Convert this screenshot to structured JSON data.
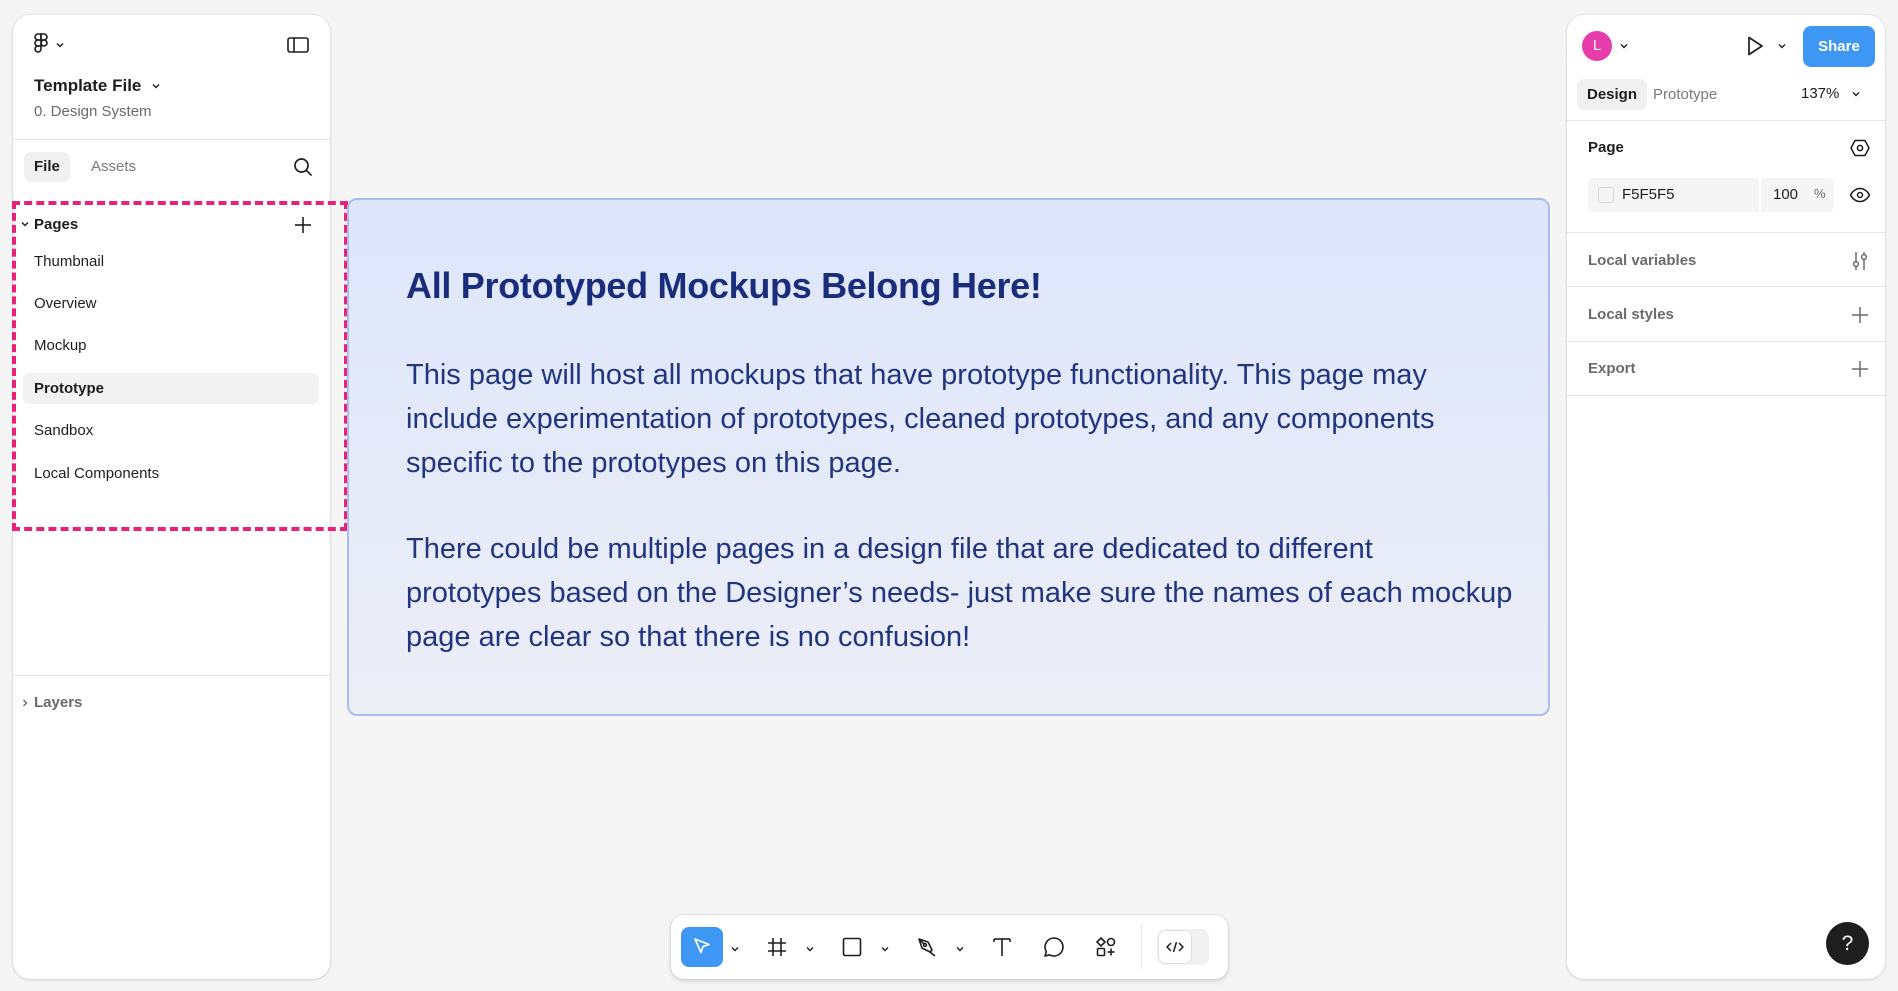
{
  "left_panel": {
    "file_title": "Template File",
    "file_subtitle": "0. Design System",
    "tabs": [
      {
        "label": "File",
        "active": true
      },
      {
        "label": "Assets",
        "active": false
      }
    ],
    "pages_label": "Pages",
    "pages": [
      {
        "label": "Thumbnail",
        "selected": false
      },
      {
        "label": "Overview",
        "selected": false
      },
      {
        "label": "Mockup",
        "selected": false
      },
      {
        "label": "Prototype",
        "selected": true
      },
      {
        "label": "Sandbox",
        "selected": false
      },
      {
        "label": "Local Components",
        "selected": false
      }
    ],
    "layers_label": "Layers",
    "highlight_color": "#E8217A"
  },
  "canvas": {
    "heading": "All Prototyped Mockups Belong Here!",
    "paragraphs": [
      "This page will host all mockups that have prototype functionality. This page may include experimentation of prototypes, cleaned prototypes, and any components specific to the prototypes on this page.",
      "There could be multiple pages in a design file that are dedicated to different prototypes based on the Designer’s needs- just make sure the names of each mockup page are clear so that there is no confusion!"
    ],
    "frame_border_color": "#A9BDF0",
    "text_color": "#1A2D7A"
  },
  "toolbar": {
    "tools": [
      {
        "name": "move-tool",
        "icon": "cursor-icon",
        "active": true
      },
      {
        "name": "frame-tool",
        "icon": "frame-icon",
        "active": false
      },
      {
        "name": "shape-tool",
        "icon": "rectangle-icon",
        "active": false
      },
      {
        "name": "pen-tool",
        "icon": "pen-icon",
        "active": false
      },
      {
        "name": "text-tool",
        "icon": "text-icon",
        "active": false
      },
      {
        "name": "comment-tool",
        "icon": "comment-icon",
        "active": false
      },
      {
        "name": "actions-tool",
        "icon": "components-icon",
        "active": false
      },
      {
        "name": "dev-mode-toggle",
        "icon": "code-icon",
        "active": false
      }
    ],
    "accent_color": "#3E97F2"
  },
  "right_panel": {
    "avatar_initial": "L",
    "avatar_color": "#E63DAB",
    "share_label": "Share",
    "tabs": [
      {
        "label": "Design",
        "active": true
      },
      {
        "label": "Prototype",
        "active": false
      }
    ],
    "zoom": "137%",
    "page_section": {
      "label": "Page",
      "color_hex": "F5F5F5",
      "opacity": "100",
      "opacity_unit": "%"
    },
    "sections": [
      {
        "label": "Local variables"
      },
      {
        "label": "Local styles"
      },
      {
        "label": "Export"
      }
    ],
    "help_label": "?"
  }
}
